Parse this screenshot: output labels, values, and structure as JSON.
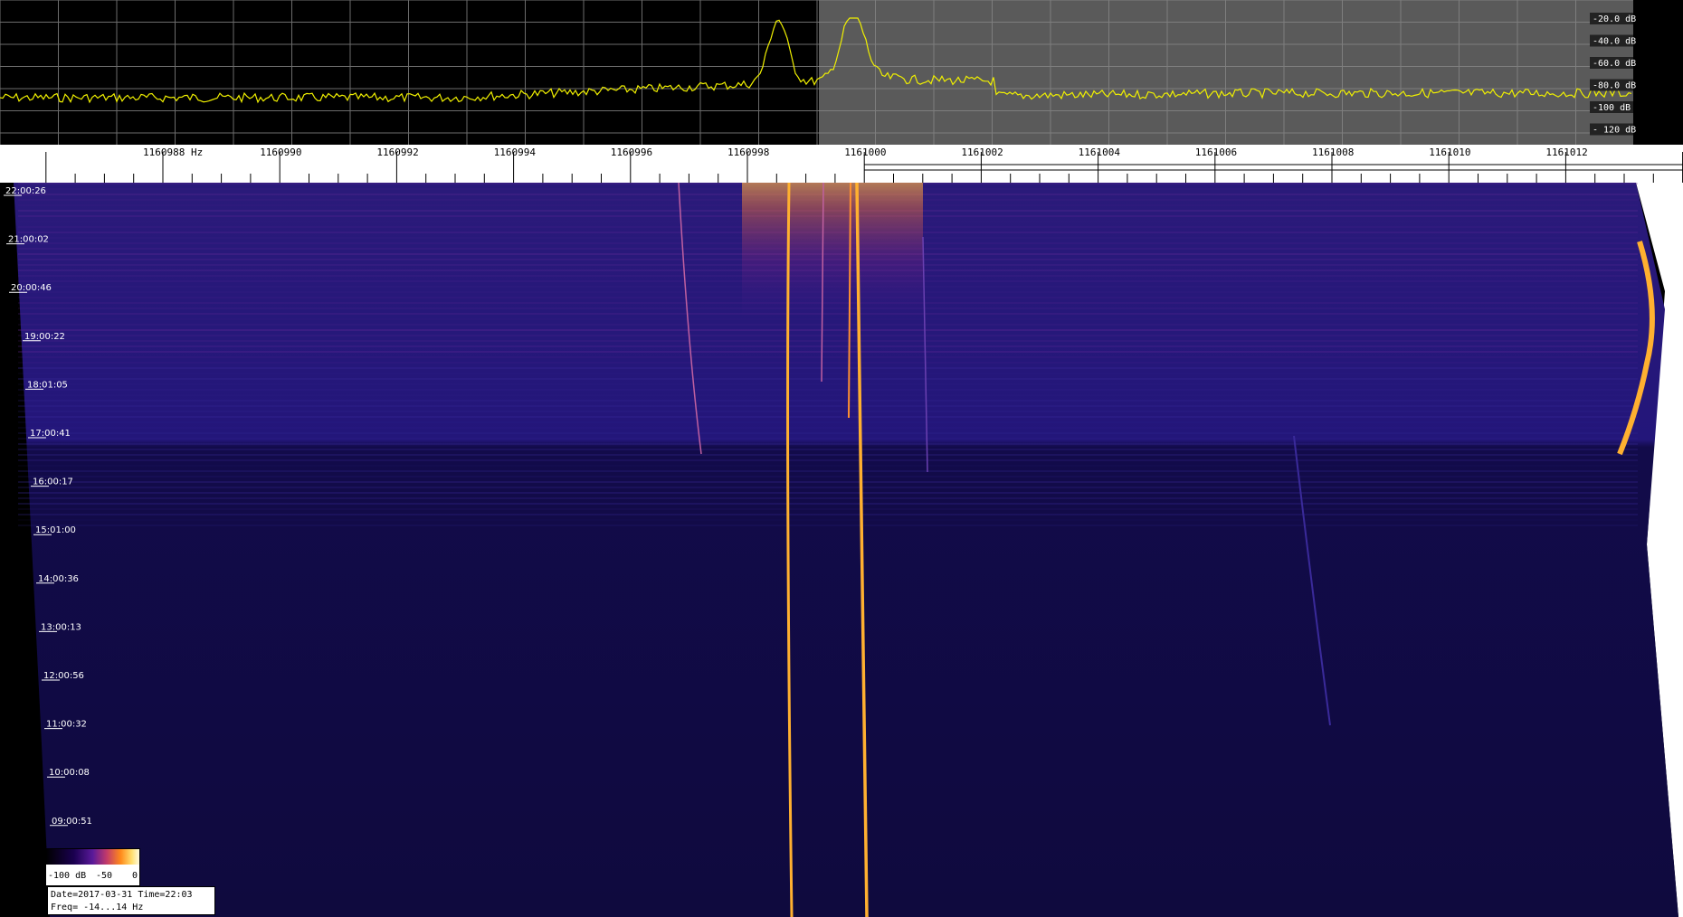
{
  "spectrum": {
    "db_labels": [
      "-20.0 dB",
      "-40.0 dB",
      "-60.0 dB",
      "-80.0 dB",
      "-100 dB",
      "- 120 dB"
    ],
    "trace_color": "#f0f000",
    "left_bg": "#000000",
    "right_bg": "#5a5a5a"
  },
  "frequency_axis": {
    "labels": [
      "1160988 Hz",
      "1160990",
      "1160992",
      "1160994",
      "1160996",
      "1160998",
      "1161000",
      "1161002",
      "1161004",
      "1161006",
      "1161008",
      "1161010",
      "1161012"
    ]
  },
  "waterfall": {
    "time_labels": [
      "22:00:26",
      "21:00:02",
      "20:00:46",
      "19:00:22",
      "18:01:05",
      "17:00:41",
      "16:00:17",
      "15:01:00",
      "14:00:36",
      "13:00:13",
      "12:00:56",
      "11:00:32",
      "10:00:08",
      "09:00:51"
    ],
    "background": "#0f0a3e"
  },
  "colorbar": {
    "labels": [
      "-100 dB",
      "-50",
      "0"
    ]
  },
  "info": {
    "date_line": "Date=2017-03-31 Time=22:03",
    "freq_line": "Freq= -14...14 Hz"
  }
}
